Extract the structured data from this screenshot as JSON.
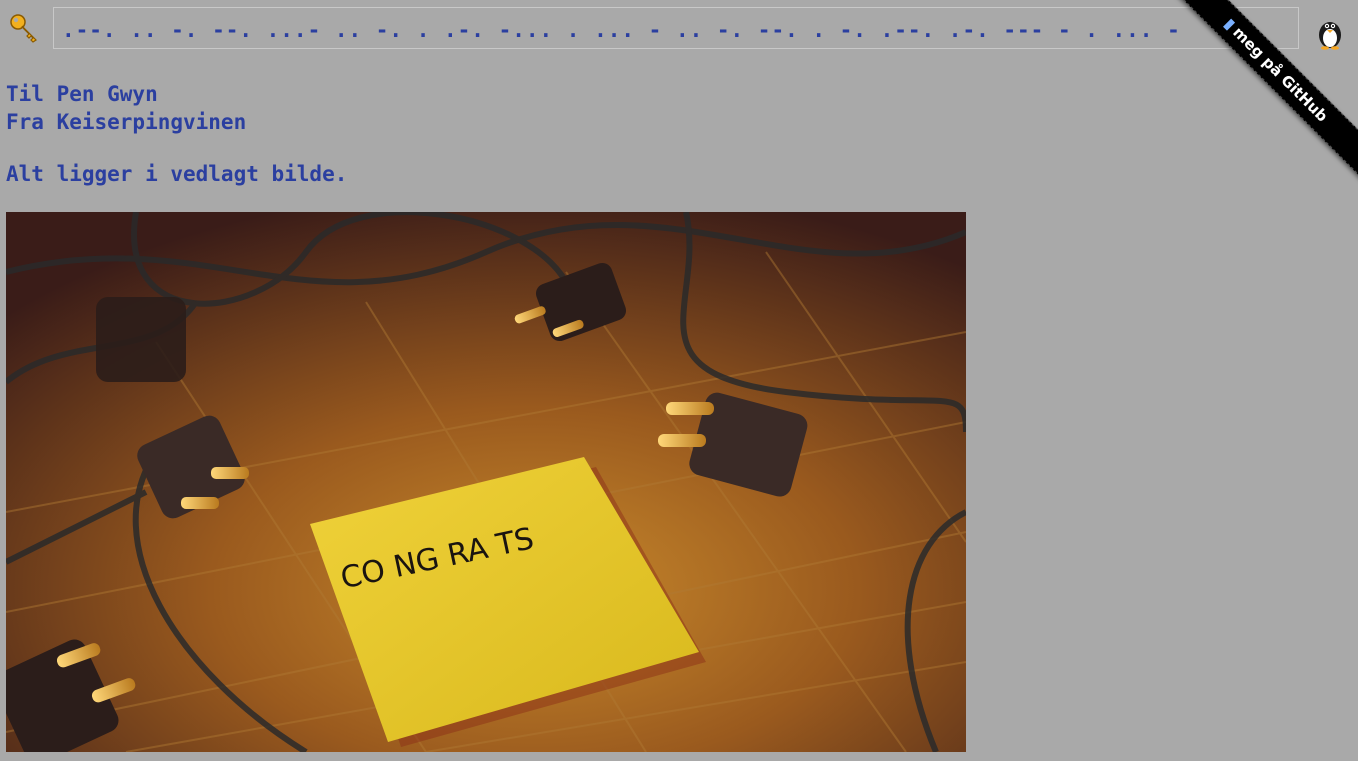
{
  "header": {
    "key_icon": "key-icon",
    "morse_text": ".--. .. -. --. ...- .. -. . .-. -... . ... - .. -. --. . -. .--. .-. --- - . ... -",
    "penguin_icon": "penguin-icon"
  },
  "ribbon": {
    "pin_icon": "pin-icon",
    "label": "meg på GitHub"
  },
  "letter": {
    "to": "Til Pen Gwyn",
    "from": "Fra Keiserpingvinen",
    "body": "Alt ligger i vedlagt bilde."
  },
  "photo": {
    "note_text": "CO NG RA TS",
    "text_color": "#2b3fa0",
    "background": "#a9a9a9"
  }
}
